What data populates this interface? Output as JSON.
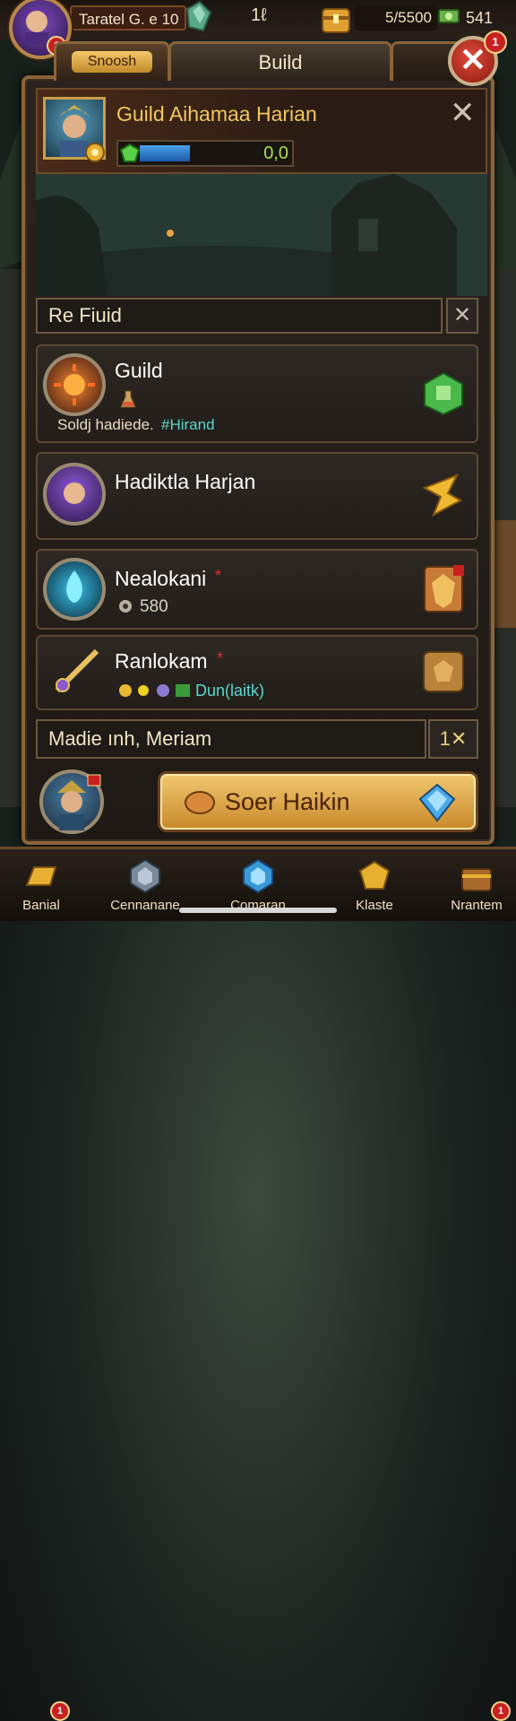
{
  "topbar": {
    "player_name": "Taratel G. e 10",
    "level": "1ℓ",
    "gold": "5/5500",
    "cash": "541",
    "notif_count": "1"
  },
  "tabs": [
    {
      "label": "Snoosh"
    },
    {
      "label": "Build"
    },
    {
      "label": ""
    }
  ],
  "close_badge": "1",
  "guild": {
    "title": "Guild Aihamaa Harian",
    "progress_value": "0,0",
    "progress_fraction": 0.33
  },
  "search": {
    "label": "Re Fiuid"
  },
  "rows": [
    {
      "name": "Guild",
      "sub_1": "Soldj hadiede.",
      "sub_2": "#Hirand",
      "icon": "sun-emblem-icon",
      "right_icon": "green-tower-icon"
    },
    {
      "name": "Hadiktla Harjan",
      "icon": "purple-hero-avatar",
      "right_icon": "gold-pennant-icon"
    },
    {
      "name": "Nealokani",
      "mark": "*",
      "sub_1": "580",
      "icon": "blue-flame-emblem-icon",
      "right_icon": "armored-shield-icon"
    },
    {
      "name": "Ranlokam",
      "mark": "*",
      "sub_1": "Dun(laitk)",
      "icon": "golden-sword-icon",
      "right_icon": "bronze-plate-icon"
    }
  ],
  "footer_row": {
    "label": "Madie ınh, Meriam",
    "count": "1✕"
  },
  "action": {
    "label": "Soer Haikin"
  },
  "nav": [
    {
      "label": "Banial",
      "badge": "1",
      "icon": "gold-bar-icon"
    },
    {
      "label": "Cennanane",
      "icon": "steel-gem-icon"
    },
    {
      "label": "Comaran",
      "icon": "blue-gem-icon"
    },
    {
      "label": "Klaste",
      "icon": "gold-cube-icon"
    },
    {
      "label": "Nrantem",
      "badge": "1",
      "icon": "treasure-chest-icon"
    }
  ],
  "colors": {
    "gold_text": "#f2c760",
    "frame": "#8a6338",
    "close_red": "#c82020",
    "progress_blue": "#2a7ad0"
  }
}
